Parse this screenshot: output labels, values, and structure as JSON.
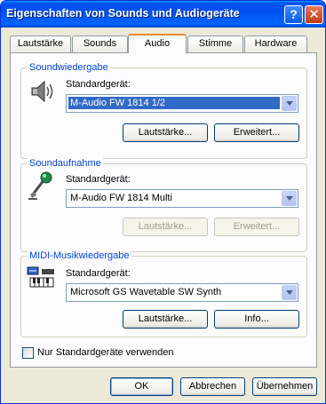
{
  "window": {
    "title": "Eigenschaften von Sounds und Audiogeräte"
  },
  "titlebar": {
    "help_glyph": "?",
    "close_glyph": "✕"
  },
  "tabs": [
    "Lautstärke",
    "Sounds",
    "Audio",
    "Stimme",
    "Hardware"
  ],
  "active_tab": "Audio",
  "playback": {
    "group_title": "Soundwiedergabe",
    "device_label": "Standardgerät:",
    "device_value": "M-Audio FW 1814 1/2",
    "volume_button": "Lautstärke...",
    "advanced_button": "Erweitert..."
  },
  "recording": {
    "group_title": "Soundaufnahme",
    "device_label": "Standardgerät:",
    "device_value": "M-Audio FW 1814 Multi",
    "volume_button": "Lautstärke...",
    "advanced_button": "Erweitert..."
  },
  "midi": {
    "group_title": "MIDI-Musikwiedergabe",
    "device_label": "Standardgerät:",
    "device_value": "Microsoft GS Wavetable SW Synth",
    "volume_button": "Lautstärke...",
    "info_button": "Info..."
  },
  "checkbox": {
    "label": "Nur Standardgeräte verwenden",
    "checked": false
  },
  "footer": {
    "ok": "OK",
    "cancel": "Abbrechen",
    "apply": "Übernehmen"
  },
  "icons": {
    "playback": "speaker-icon",
    "recording": "microphone-icon",
    "midi": "midi-keyboard-icon"
  },
  "colors": {
    "titlebar": "#0054e3",
    "group_title": "#0046d5",
    "selection": "#316ac5",
    "active_tab_accent": "#e68b2c"
  }
}
